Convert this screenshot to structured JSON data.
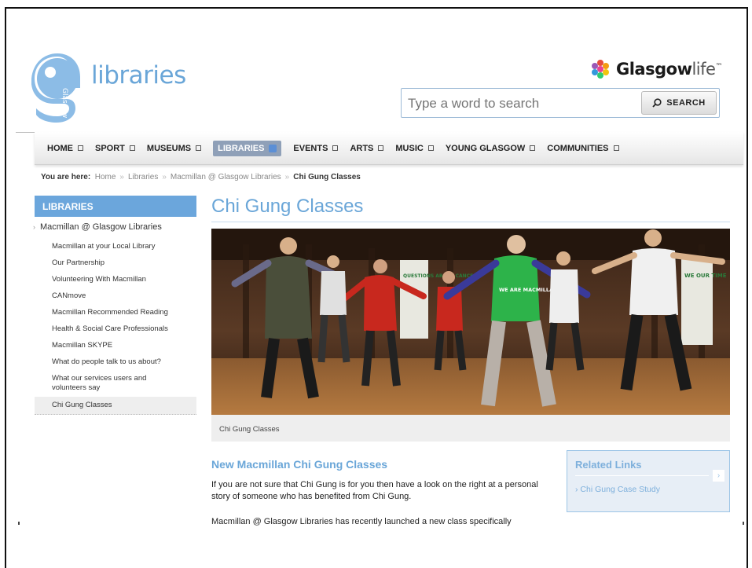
{
  "header": {
    "logo_text": "libraries",
    "logo_word": "Glasgow",
    "brand_bold": "Glasgow",
    "brand_light": "life",
    "search_placeholder": "Type a word to search",
    "search_button": "SEARCH"
  },
  "nav": {
    "items": [
      {
        "label": "HOME"
      },
      {
        "label": "SPORT"
      },
      {
        "label": "MUSEUMS"
      },
      {
        "label": "LIBRARIES",
        "active": true
      },
      {
        "label": "EVENTS"
      },
      {
        "label": "ARTS"
      },
      {
        "label": "MUSIC"
      },
      {
        "label": "YOUNG GLASGOW"
      },
      {
        "label": "COMMUNITIES"
      }
    ]
  },
  "breadcrumb": {
    "label": "You are here:",
    "items": [
      "Home",
      "Libraries",
      "Macmillan @ Glasgow Libraries"
    ],
    "current": "Chi Gung Classes"
  },
  "sidebar": {
    "heading": "LIBRARIES",
    "parent": "Macmillan @ Glasgow Libraries",
    "items": [
      "Macmillan at your Local Library",
      "Our Partnership",
      "Volunteering With Macmillan",
      "CANmove",
      "Macmillan Recommended Reading",
      "Health & Social Care Professionals",
      "Macmillan SKYPE",
      "What do people talk to us about?",
      "What our services users and volunteers say",
      "Chi Gung Classes"
    ],
    "active_index": 9
  },
  "main": {
    "title": "Chi Gung Classes",
    "photo_caption": "Chi Gung Classes",
    "shirt_text": "WE ARE MACMILLAN.",
    "banner_left": "QUESTIONS ABOUT CANCER?",
    "banner_right": "WE OUR TIME",
    "subtitle": "New Macmillan Chi Gung Classes",
    "para1": "If you are not sure that Chi Gung is for you then have a look on the right at a personal story of someone who has benefited from Chi Gung.",
    "para2": "Macmillan @ Glasgow Libraries has recently launched a new class specifically"
  },
  "related": {
    "title": "Related Links",
    "links": [
      "Chi Gung Case Study"
    ]
  },
  "colors": {
    "accent": "#6aa6d8",
    "nav_active": "#8fa0b8",
    "sidebar_head": "#6ba6dc"
  }
}
